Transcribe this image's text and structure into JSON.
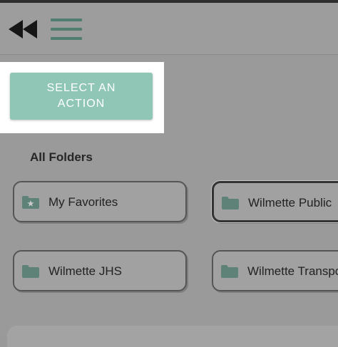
{
  "header": {
    "back_icon": "rewind-icon",
    "menu_icon": "hamburger-menu-icon",
    "accent_color": "#4f7d6f"
  },
  "action": {
    "label": "SELECT AN ACTION",
    "color": "#8fc6b5"
  },
  "folders_section": {
    "title": "All Folders",
    "items": [
      {
        "label": "My Favorites",
        "icon": "folder-star-icon",
        "selected": false
      },
      {
        "label": "Wilmette Public",
        "icon": "folder-icon",
        "selected": true
      },
      {
        "label": "Wilmette JHS",
        "icon": "folder-icon",
        "selected": false
      },
      {
        "label": "Wilmette Transpo",
        "icon": "folder-icon",
        "selected": false
      }
    ]
  }
}
